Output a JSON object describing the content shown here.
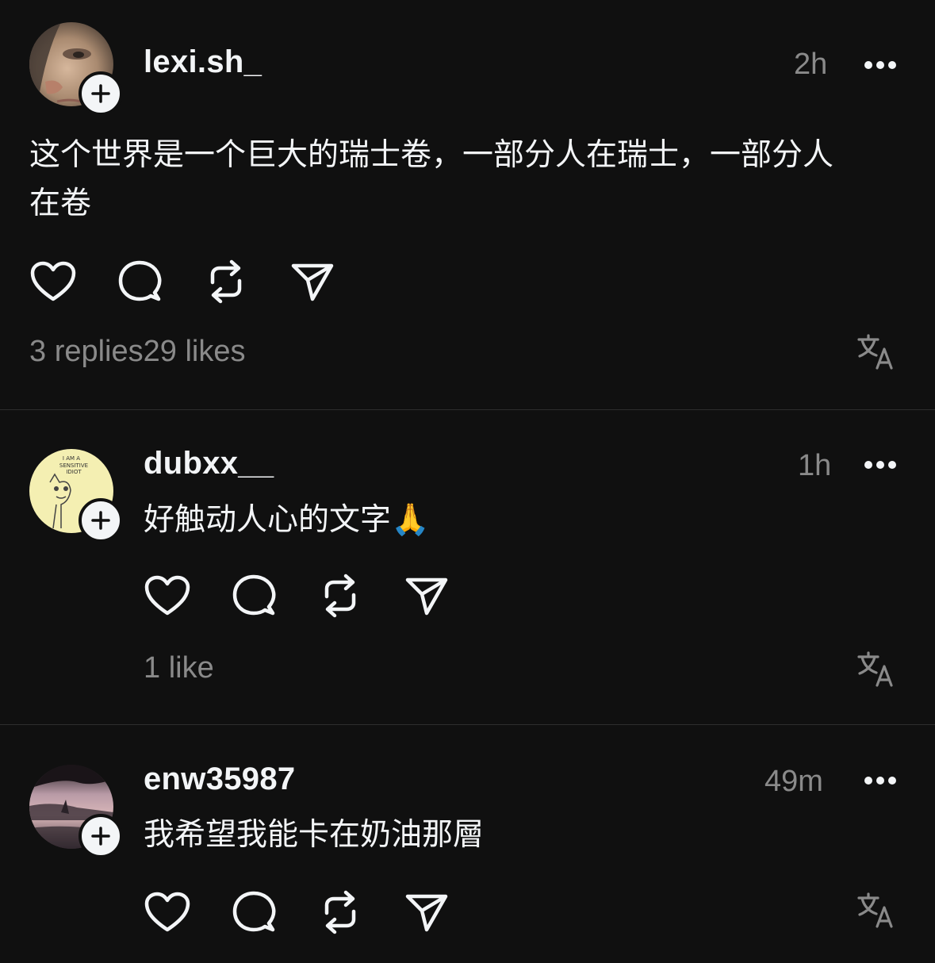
{
  "posts": [
    {
      "username": "lexi.sh_",
      "time": "2h",
      "text_line1": "这个世界是一个巨大的瑞士卷，一部分人在瑞士，一部分人",
      "text_line2": "在卷",
      "replies": "3 replies",
      "likes": "29 likes"
    },
    {
      "username": "dubxx__",
      "time": "1h",
      "text": "好触动人心的文字🙏",
      "avatar_text": [
        "I AM A",
        "SENSITIVE",
        "IDIOT"
      ],
      "likes": "1 like"
    },
    {
      "username": "enw35987",
      "time": "49m",
      "text": "我希望我能卡在奶油那層"
    }
  ],
  "icons": {
    "like": "heart-icon",
    "reply": "comment-icon",
    "repost": "repost-icon",
    "share": "send-icon",
    "translate": "translate-icon",
    "more": "more-icon",
    "follow": "plus-icon"
  },
  "colors": {
    "background": "#101010",
    "text": "#f3f5f7",
    "muted": "#8a8a8a",
    "divider": "#2e2e2e"
  }
}
